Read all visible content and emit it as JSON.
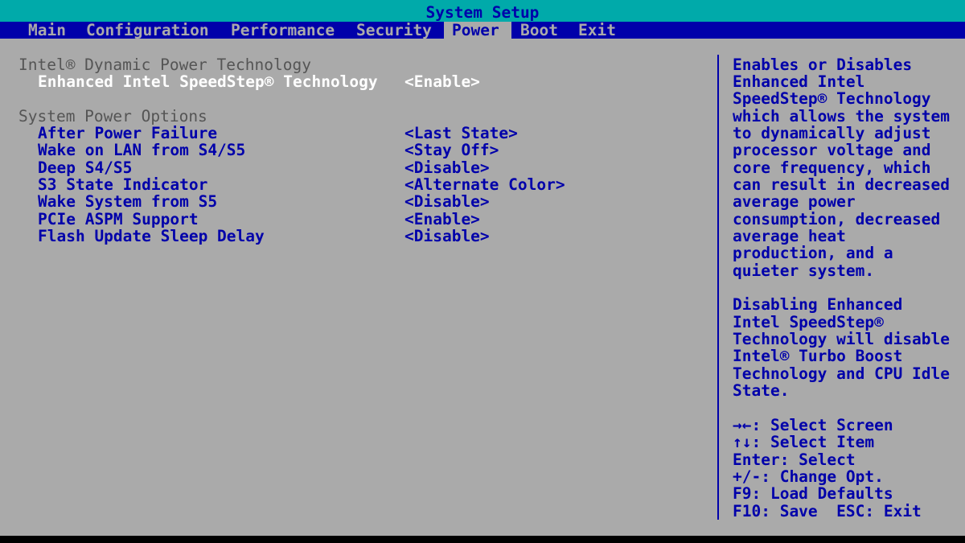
{
  "title": "System Setup",
  "menu": [
    {
      "label": "Main"
    },
    {
      "label": "Configuration"
    },
    {
      "label": "Performance"
    },
    {
      "label": "Security"
    },
    {
      "label": "Power"
    },
    {
      "label": "Boot"
    },
    {
      "label": "Exit"
    }
  ],
  "active_tab": "Power",
  "sections": {
    "dynamic_power": {
      "heading": "Intel® Dynamic Power Technology",
      "items": [
        {
          "label": "Enhanced Intel SpeedStep® Technology",
          "value": "<Enable>",
          "selected": true
        }
      ]
    },
    "power_options": {
      "heading": "System Power Options",
      "items": [
        {
          "label": "After Power Failure",
          "value": "<Last State>"
        },
        {
          "label": "Wake on LAN from S4/S5",
          "value": "<Stay Off>"
        },
        {
          "label": "Deep S4/S5",
          "value": "<Disable>"
        },
        {
          "label": "S3 State Indicator",
          "value": "<Alternate Color>"
        },
        {
          "label": "Wake System from S5",
          "value": "<Disable>"
        },
        {
          "label": "PCIe ASPM Support",
          "value": "<Enable>"
        },
        {
          "label": "Flash Update Sleep Delay",
          "value": "<Disable>"
        }
      ]
    }
  },
  "help": {
    "description": [
      "Enables or Disables",
      "Enhanced Intel",
      "SpeedStep® Technology",
      "which allows the system",
      "to dynamically adjust",
      "processor voltage and",
      "core frequency, which",
      "can result in decreased",
      "average power",
      "consumption, decreased",
      "average heat",
      "production, and a",
      "quieter system."
    ],
    "note": [
      "Disabling Enhanced",
      "Intel SpeedStep®",
      "Technology will disable",
      "Intel® Turbo Boost",
      "Technology and CPU Idle",
      "State."
    ],
    "keys": [
      "→←: Select Screen",
      "↑↓: Select Item",
      "Enter: Select",
      "+/-: Change Opt.",
      "F9: Load Defaults",
      "F10: Save  ESC: Exit"
    ]
  },
  "colors": {
    "background": "#aaaaaa",
    "title_bar": "#00aaaa",
    "menu_bar": "#0000aa",
    "text": "#0000aa",
    "highlight_text": "#ffffff",
    "section_text": "#555555"
  }
}
